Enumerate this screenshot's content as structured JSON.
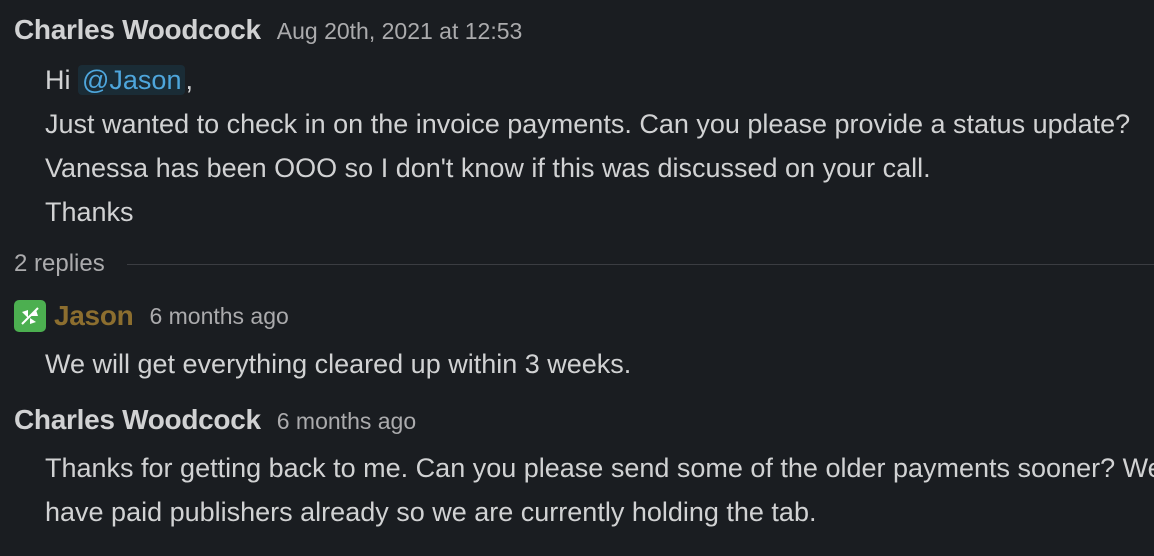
{
  "messages": [
    {
      "author": "Charles Woodcock",
      "timestamp": "Aug 20th, 2021 at 12:53",
      "greeting": "Hi ",
      "mention": "@Jason",
      "greeting_suffix": ",",
      "lines": [
        "Just wanted to check in on the invoice payments. Can you please provide a status update? Vanessa has been OOO so I don't know if this was discussed on your call.",
        "Thanks"
      ]
    },
    {
      "author": "Jason",
      "timestamp": "6 months ago",
      "avatar_icon": "bot-leaf-icon",
      "avatar_color": "#4caf50",
      "text": "We will get everything cleared up within 3 weeks."
    },
    {
      "author": "Charles Woodcock",
      "timestamp": "6 months ago",
      "text": "Thanks for getting back to me. Can you please send some of the older payments sooner? We have paid publishers already so we are currently holding the tab."
    }
  ],
  "thread": {
    "replies_label": "2 replies"
  },
  "colors": {
    "background": "#1a1d21",
    "text": "#d1d2d3",
    "muted": "#ababad",
    "mention": "#4ea6dc",
    "bot_name": "#8c6e2f"
  }
}
